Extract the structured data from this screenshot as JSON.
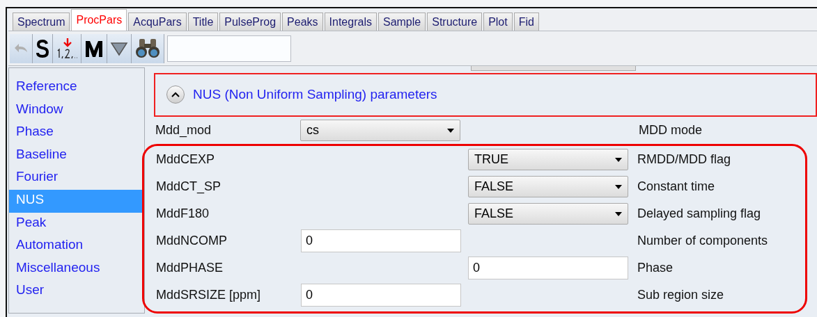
{
  "tabs": [
    {
      "label": "Spectrum",
      "selected": false
    },
    {
      "label": "ProcPars",
      "selected": true
    },
    {
      "label": "AcquPars",
      "selected": false
    },
    {
      "label": "Title",
      "selected": false
    },
    {
      "label": "PulseProg",
      "selected": false
    },
    {
      "label": "Peaks",
      "selected": false
    },
    {
      "label": "Integrals",
      "selected": false
    },
    {
      "label": "Sample",
      "selected": false
    },
    {
      "label": "Structure",
      "selected": false
    },
    {
      "label": "Plot",
      "selected": false
    },
    {
      "label": "Fid",
      "selected": false
    }
  ],
  "sidebar": {
    "items": [
      {
        "label": "Reference",
        "selected": false
      },
      {
        "label": "Window",
        "selected": false
      },
      {
        "label": "Phase",
        "selected": false
      },
      {
        "label": "Baseline",
        "selected": false
      },
      {
        "label": "Fourier",
        "selected": false
      },
      {
        "label": "NUS",
        "selected": true
      },
      {
        "label": "Peak",
        "selected": false
      },
      {
        "label": "Automation",
        "selected": false
      },
      {
        "label": "Miscellaneous",
        "selected": false
      },
      {
        "label": "User",
        "selected": false
      }
    ]
  },
  "section": {
    "title": "NUS (Non Uniform Sampling) parameters",
    "expanded": true,
    "highlighted": true
  },
  "parameters": [
    {
      "name": "Mdd_mod",
      "kind": "select",
      "left_field": "cs",
      "description": "MDD mode"
    },
    {
      "name": "MddCEXP",
      "kind": "select",
      "right_field": "TRUE",
      "description": "RMDD/MDD flag"
    },
    {
      "name": "MddCT_SP",
      "kind": "select",
      "right_field": "FALSE",
      "description": "Constant time"
    },
    {
      "name": "MddF180",
      "kind": "select",
      "right_field": "FALSE",
      "description": "Delayed sampling flag"
    },
    {
      "name": "MddNCOMP",
      "kind": "input",
      "left_field": "0",
      "description": "Number of components"
    },
    {
      "name": "MddPHASE",
      "kind": "input",
      "right_field": "0",
      "description": "Phase"
    },
    {
      "name": "MddSRSIZE [ppm]",
      "kind": "input",
      "left_field": "0",
      "description": "Sub region size"
    }
  ],
  "highlight_group": {
    "shown": true
  }
}
